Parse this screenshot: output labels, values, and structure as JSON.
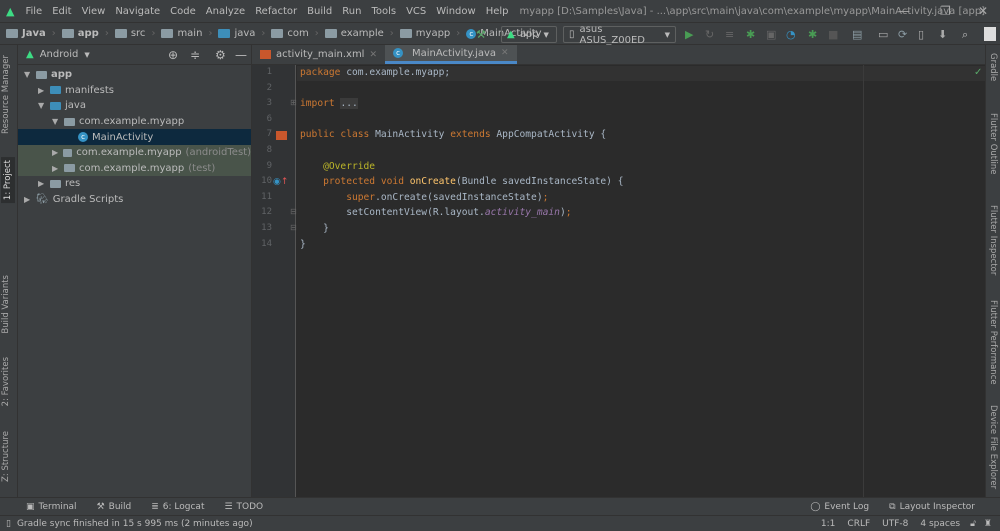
{
  "menu": [
    "File",
    "Edit",
    "View",
    "Navigate",
    "Code",
    "Analyze",
    "Refactor",
    "Build",
    "Run",
    "Tools",
    "VCS",
    "Window",
    "Help"
  ],
  "window_title": "myapp [D:\\Samples\\Java] - ...\\app\\src\\main\\java\\com\\example\\myapp\\MainActivity.java [app]",
  "breadcrumbs": [
    "Java",
    "app",
    "src",
    "main",
    "java",
    "com",
    "example",
    "myapp",
    "MainActivity"
  ],
  "run_config": "app",
  "device": "asus ASUS_Z00ED",
  "project": {
    "view": "Android",
    "tree": [
      {
        "label": "app",
        "depth": 0,
        "arrow": "▼",
        "type": "module"
      },
      {
        "label": "manifests",
        "depth": 1,
        "arrow": "▶",
        "type": "folder-blue"
      },
      {
        "label": "java",
        "depth": 1,
        "arrow": "▼",
        "type": "folder-blue"
      },
      {
        "label": "com.example.myapp",
        "depth": 2,
        "arrow": "▼",
        "type": "package"
      },
      {
        "label": "MainActivity",
        "depth": 3,
        "arrow": "",
        "type": "class",
        "selected": true
      },
      {
        "label": "com.example.myapp",
        "suffix": "(androidTest)",
        "depth": 2,
        "arrow": "▶",
        "type": "package",
        "test": true
      },
      {
        "label": "com.example.myapp",
        "suffix": "(test)",
        "depth": 2,
        "arrow": "▶",
        "type": "package",
        "test": true
      },
      {
        "label": "res",
        "depth": 1,
        "arrow": "▶",
        "type": "folder"
      },
      {
        "label": "Gradle Scripts",
        "depth": 0,
        "arrow": "▶",
        "type": "gradle"
      }
    ]
  },
  "tabs": [
    {
      "label": "activity_main.xml",
      "active": false
    },
    {
      "label": "MainActivity.java",
      "active": true
    }
  ],
  "code": [
    {
      "n": "1",
      "t": [
        [
          "package",
          "kw"
        ],
        [
          " com.example.myapp;",
          ""
        ]
      ]
    },
    {
      "n": "2",
      "t": []
    },
    {
      "n": "3",
      "t": [
        [
          "import",
          "kw"
        ],
        [
          " ",
          ""
        ],
        [
          "...",
          "fold-t"
        ]
      ]
    },
    {
      "n": "6",
      "t": []
    },
    {
      "n": "7",
      "t": [
        [
          "public class ",
          "kw"
        ],
        [
          "MainActivity ",
          ""
        ],
        [
          "extends ",
          "kw"
        ],
        [
          "AppCompatActivity {",
          ""
        ]
      ]
    },
    {
      "n": "8",
      "t": []
    },
    {
      "n": "9",
      "t": [
        [
          "    @Override",
          "ann"
        ]
      ]
    },
    {
      "n": "10",
      "t": [
        [
          "    protected void ",
          "kw"
        ],
        [
          "onCreate",
          "fn"
        ],
        [
          "(Bundle savedInstanceState) {",
          ""
        ]
      ]
    },
    {
      "n": "11",
      "t": [
        [
          "        super",
          "kw"
        ],
        [
          ".onCreate(savedInstanceState)",
          ""
        ],
        [
          ";",
          "kw"
        ]
      ]
    },
    {
      "n": "12",
      "t": [
        [
          "        setContentView(R.layout.",
          ""
        ],
        [
          "activity_main",
          "it"
        ],
        [
          ")",
          ""
        ],
        [
          ";",
          "kw"
        ]
      ]
    },
    {
      "n": "13",
      "t": [
        [
          "    }",
          ""
        ]
      ]
    },
    {
      "n": "14",
      "t": [
        [
          "}",
          ""
        ]
      ]
    }
  ],
  "left_tools": [
    "Resource Manager",
    "1: Project",
    "Build Variants",
    "2: Favorites",
    "Z: Structure"
  ],
  "right_tools": [
    "Gradle",
    "Flutter Outline",
    "Flutter Inspector",
    "Flutter Performance",
    "Device File Explorer"
  ],
  "bottom_tools": [
    "Terminal",
    "Build",
    "6: Logcat",
    "TODO"
  ],
  "bottom_right_tools": [
    "Event Log",
    "Layout Inspector"
  ],
  "status": {
    "message": "Gradle sync finished in 15 s 995 ms (2 minutes ago)",
    "position": "1:1",
    "line_sep": "CRLF",
    "encoding": "UTF-8",
    "indent": "4 spaces"
  }
}
